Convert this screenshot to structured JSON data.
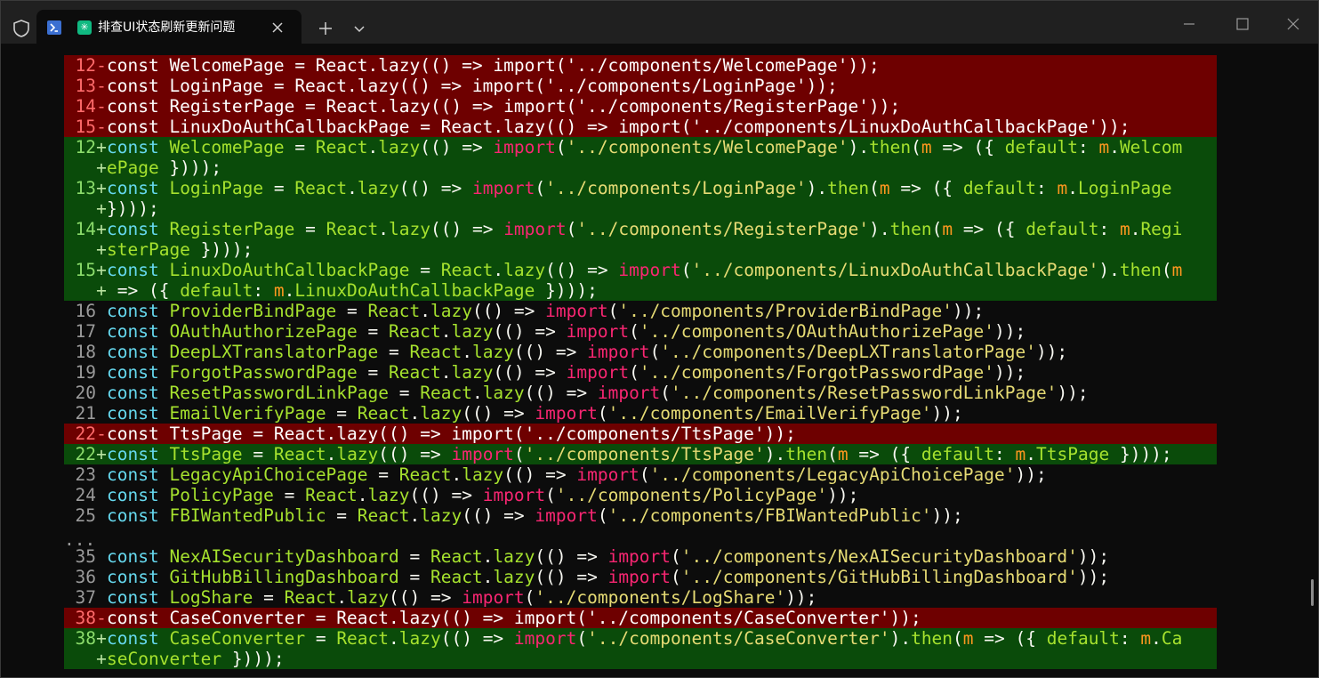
{
  "window": {
    "tab_title": "排查UI状态刷新更新问题",
    "new_tab_label": "+",
    "app_icon_glyph": "✳"
  },
  "diff": {
    "ellipsis": "...",
    "lines": [
      {
        "type": "removed",
        "ln": "12",
        "sign": "-",
        "text": "const WelcomePage = React.lazy(() => import('../components/WelcomePage'));"
      },
      {
        "type": "removed",
        "ln": "13",
        "sign": "-",
        "text": "const LoginPage = React.lazy(() => import('../components/LoginPage'));"
      },
      {
        "type": "removed",
        "ln": "14",
        "sign": "-",
        "text": "const RegisterPage = React.lazy(() => import('../components/RegisterPage'));"
      },
      {
        "type": "removed",
        "ln": "15",
        "sign": "-",
        "text": "const LinuxDoAuthCallbackPage = React.lazy(() => import('../components/LinuxDoAuthCallbackPage'));"
      },
      {
        "type": "added",
        "ln": "12",
        "sign": "+",
        "text": "const WelcomePage = React.lazy(() => import('../components/WelcomePage').then(m => ({ default: m.Welcom"
      },
      {
        "type": "added",
        "ln": "",
        "sign": "+",
        "text": "ePage })));"
      },
      {
        "type": "added",
        "ln": "13",
        "sign": "+",
        "text": "const LoginPage = React.lazy(() => import('../components/LoginPage').then(m => ({ default: m.LoginPage "
      },
      {
        "type": "added",
        "ln": "",
        "sign": "+",
        "text": "})));"
      },
      {
        "type": "added",
        "ln": "14",
        "sign": "+",
        "text": "const RegisterPage = React.lazy(() => import('../components/RegisterPage').then(m => ({ default: m.Regi"
      },
      {
        "type": "added",
        "ln": "",
        "sign": "+",
        "text": "sterPage })));"
      },
      {
        "type": "added",
        "ln": "15",
        "sign": "+",
        "text": "const LinuxDoAuthCallbackPage = React.lazy(() => import('../components/LinuxDoAuthCallbackPage').then(m"
      },
      {
        "type": "added",
        "ln": "",
        "sign": "+",
        "text": " => ({ default: m.LinuxDoAuthCallbackPage })));"
      },
      {
        "type": "context",
        "ln": "16",
        "sign": " ",
        "text": "const ProviderBindPage = React.lazy(() => import('../components/ProviderBindPage'));"
      },
      {
        "type": "context",
        "ln": "17",
        "sign": " ",
        "text": "const OAuthAuthorizePage = React.lazy(() => import('../components/OAuthAuthorizePage'));"
      },
      {
        "type": "context",
        "ln": "18",
        "sign": " ",
        "text": "const DeepLXTranslatorPage = React.lazy(() => import('../components/DeepLXTranslatorPage'));"
      },
      {
        "type": "context",
        "ln": "19",
        "sign": " ",
        "text": "const ForgotPasswordPage = React.lazy(() => import('../components/ForgotPasswordPage'));"
      },
      {
        "type": "context",
        "ln": "20",
        "sign": " ",
        "text": "const ResetPasswordLinkPage = React.lazy(() => import('../components/ResetPasswordLinkPage'));"
      },
      {
        "type": "context",
        "ln": "21",
        "sign": " ",
        "text": "const EmailVerifyPage = React.lazy(() => import('../components/EmailVerifyPage'));"
      },
      {
        "type": "removed",
        "ln": "22",
        "sign": "-",
        "text": "const TtsPage = React.lazy(() => import('../components/TtsPage'));"
      },
      {
        "type": "added",
        "ln": "22",
        "sign": "+",
        "text": "const TtsPage = React.lazy(() => import('../components/TtsPage').then(m => ({ default: m.TtsPage })));"
      },
      {
        "type": "context",
        "ln": "23",
        "sign": " ",
        "text": "const LegacyApiChoicePage = React.lazy(() => import('../components/LegacyApiChoicePage'));"
      },
      {
        "type": "context",
        "ln": "24",
        "sign": " ",
        "text": "const PolicyPage = React.lazy(() => import('../components/PolicyPage'));"
      },
      {
        "type": "context",
        "ln": "25",
        "sign": " ",
        "text": "const FBIWantedPublic = React.lazy(() => import('../components/FBIWantedPublic'));"
      },
      {
        "type": "ellipsis",
        "ln": "",
        "sign": "",
        "text": "..."
      },
      {
        "type": "context",
        "ln": "35",
        "sign": " ",
        "text": "const NexAISecurityDashboard = React.lazy(() => import('../components/NexAISecurityDashboard'));"
      },
      {
        "type": "context",
        "ln": "36",
        "sign": " ",
        "text": "const GitHubBillingDashboard = React.lazy(() => import('../components/GitHubBillingDashboard'));"
      },
      {
        "type": "context",
        "ln": "37",
        "sign": " ",
        "text": "const LogShare = React.lazy(() => import('../components/LogShare'));"
      },
      {
        "type": "removed",
        "ln": "38",
        "sign": "-",
        "text": "const CaseConverter = React.lazy(() => import('../components/CaseConverter'));"
      },
      {
        "type": "added",
        "ln": "38",
        "sign": "+",
        "text": "const CaseConverter = React.lazy(() => import('../components/CaseConverter').then(m => ({ default: m.Ca"
      },
      {
        "type": "added",
        "ln": "",
        "sign": "+",
        "text": "seConverter })));"
      }
    ]
  },
  "colors": {
    "removed_bg": "#6e0000",
    "added_bg": "#0a4b0a",
    "keyword": "#66d9ef",
    "identifier": "#a6e22e",
    "import_kw": "#f92672",
    "string": "#e6db74"
  }
}
